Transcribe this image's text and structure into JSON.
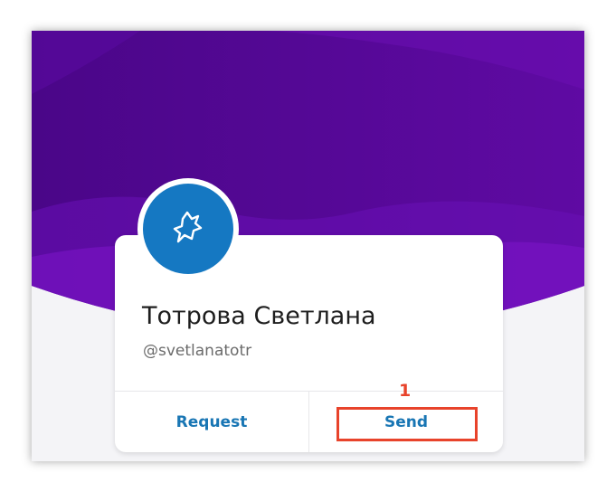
{
  "profile": {
    "name": "Тотрова Светлана",
    "handle": "@svetlanatotr"
  },
  "actions": {
    "request_label": "Request",
    "send_label": "Send"
  },
  "annotation": {
    "marker": "1"
  },
  "colors": {
    "banner_dark": "#4b0585",
    "banner_light": "#7a12c4",
    "avatar_bg": "#1578c2",
    "action_text": "#1976b4",
    "highlight": "#e8432b"
  },
  "icons": {
    "avatar": "chat-bubble-icon"
  }
}
